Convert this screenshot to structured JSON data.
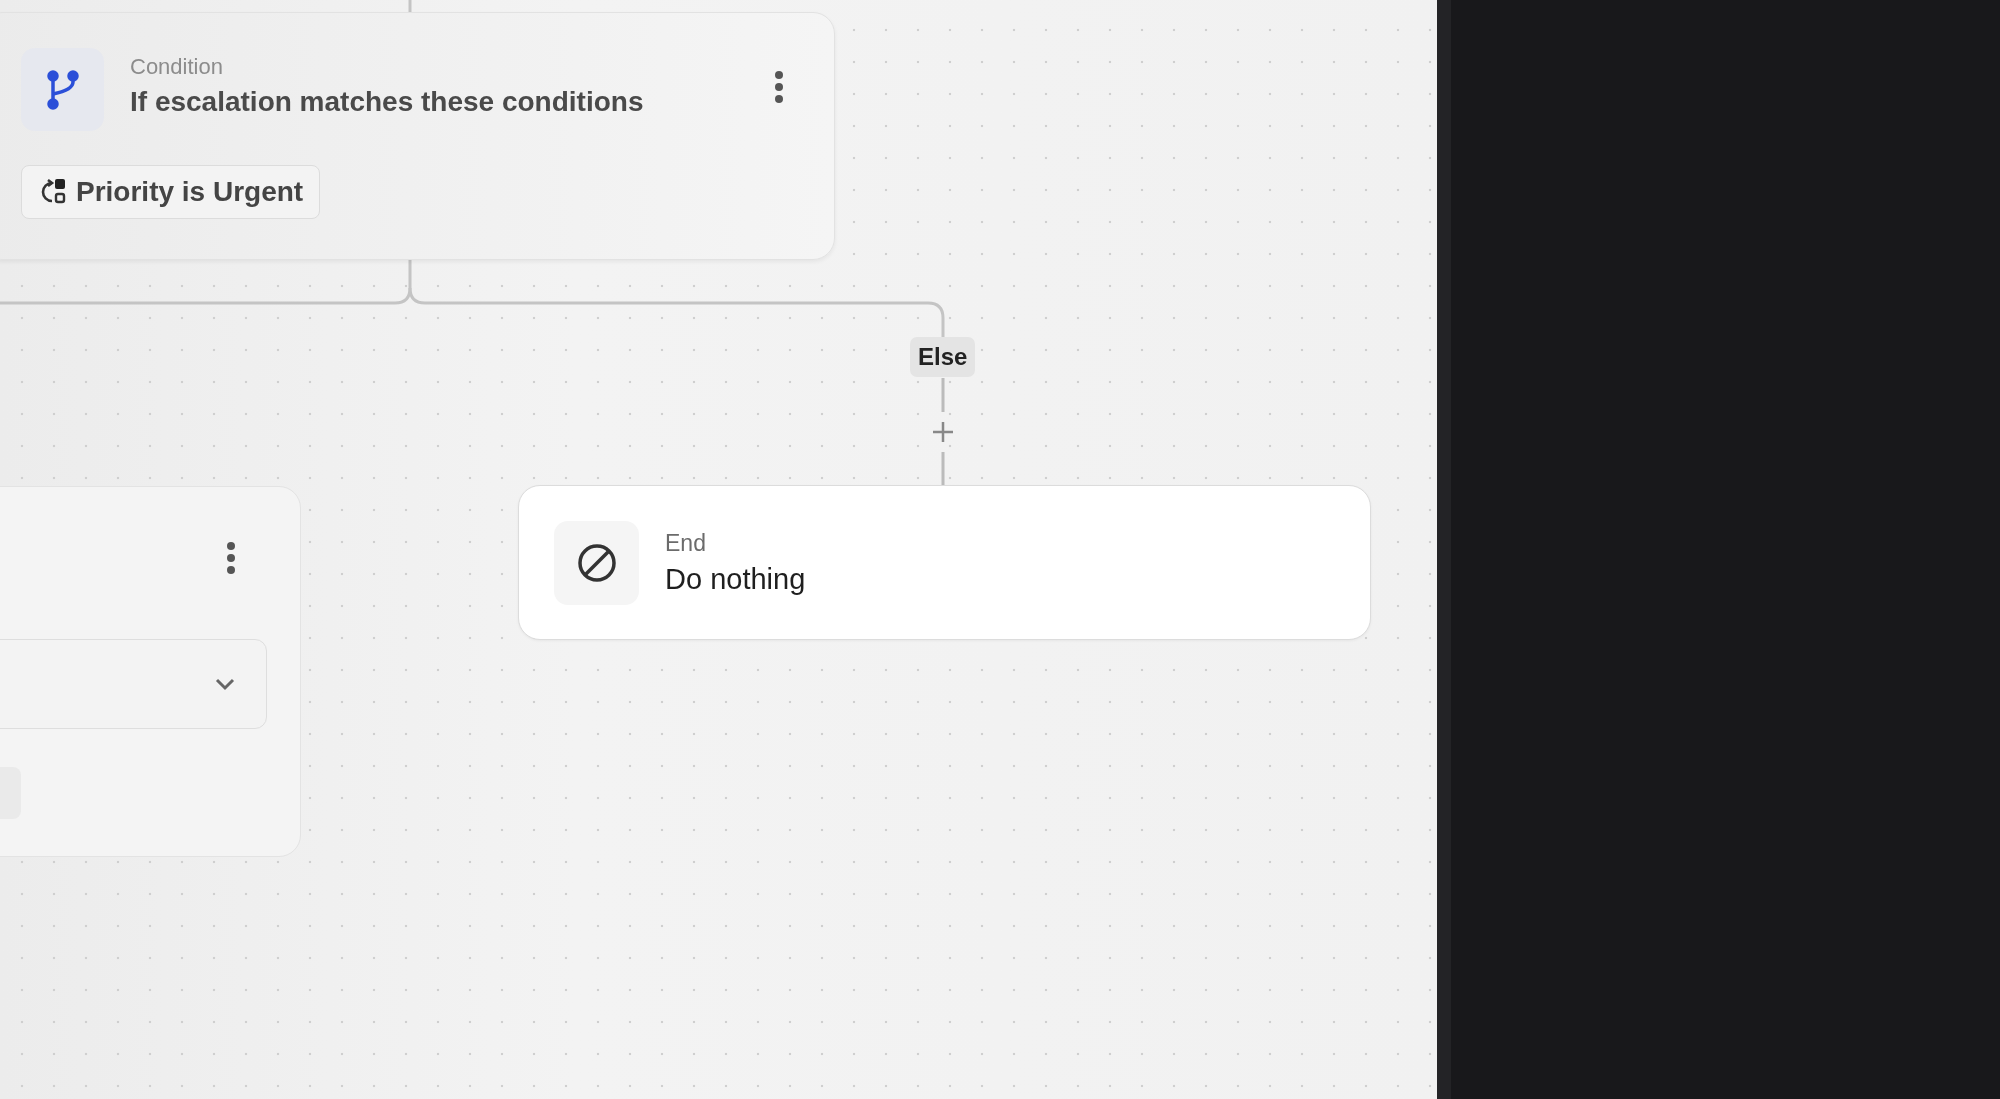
{
  "nodes": [
    {
      "kind": "condition",
      "type_label": "Condition",
      "title": "If escalation matches these conditions",
      "conditions": [
        "Priority is Urgent"
      ]
    },
    {
      "kind": "action"
    },
    {
      "kind": "end",
      "type_label": "End",
      "title": "Do nothing"
    }
  ],
  "branches": [
    {
      "label": "Else"
    }
  ]
}
